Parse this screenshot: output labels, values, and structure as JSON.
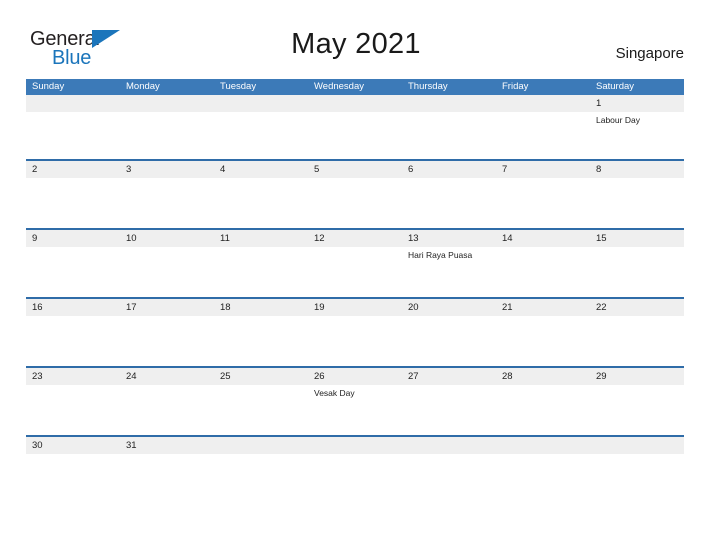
{
  "brand": {
    "name_part1": "General",
    "name_part2": "Blue",
    "flag_icon": "blue-triangle-flag",
    "primary_color": "#1b75bb"
  },
  "header": {
    "title": "May 2021",
    "region": "Singapore",
    "header_bar_color": "#3c7ab8",
    "row_band_color": "#efefef",
    "row_divider_color": "#2f6ca8"
  },
  "calendar": {
    "month": "May",
    "year": "2021",
    "weekday_headers": [
      "Sunday",
      "Monday",
      "Tuesday",
      "Wednesday",
      "Thursday",
      "Friday",
      "Saturday"
    ],
    "weeks": [
      {
        "days": [
          {
            "date": "",
            "events": []
          },
          {
            "date": "",
            "events": []
          },
          {
            "date": "",
            "events": []
          },
          {
            "date": "",
            "events": []
          },
          {
            "date": "",
            "events": []
          },
          {
            "date": "",
            "events": []
          },
          {
            "date": "1",
            "events": [
              "Labour Day"
            ]
          }
        ]
      },
      {
        "days": [
          {
            "date": "2",
            "events": []
          },
          {
            "date": "3",
            "events": []
          },
          {
            "date": "4",
            "events": []
          },
          {
            "date": "5",
            "events": []
          },
          {
            "date": "6",
            "events": []
          },
          {
            "date": "7",
            "events": []
          },
          {
            "date": "8",
            "events": []
          }
        ]
      },
      {
        "days": [
          {
            "date": "9",
            "events": []
          },
          {
            "date": "10",
            "events": []
          },
          {
            "date": "11",
            "events": []
          },
          {
            "date": "12",
            "events": []
          },
          {
            "date": "13",
            "events": [
              "Hari Raya Puasa"
            ]
          },
          {
            "date": "14",
            "events": []
          },
          {
            "date": "15",
            "events": []
          }
        ]
      },
      {
        "days": [
          {
            "date": "16",
            "events": []
          },
          {
            "date": "17",
            "events": []
          },
          {
            "date": "18",
            "events": []
          },
          {
            "date": "19",
            "events": []
          },
          {
            "date": "20",
            "events": []
          },
          {
            "date": "21",
            "events": []
          },
          {
            "date": "22",
            "events": []
          }
        ]
      },
      {
        "days": [
          {
            "date": "23",
            "events": []
          },
          {
            "date": "24",
            "events": []
          },
          {
            "date": "25",
            "events": []
          },
          {
            "date": "26",
            "events": [
              "Vesak Day"
            ]
          },
          {
            "date": "27",
            "events": []
          },
          {
            "date": "28",
            "events": []
          },
          {
            "date": "29",
            "events": []
          }
        ]
      },
      {
        "days": [
          {
            "date": "30",
            "events": []
          },
          {
            "date": "31",
            "events": []
          },
          {
            "date": "",
            "events": []
          },
          {
            "date": "",
            "events": []
          },
          {
            "date": "",
            "events": []
          },
          {
            "date": "",
            "events": []
          },
          {
            "date": "",
            "events": []
          }
        ]
      }
    ],
    "week_body_heights": [
      47,
      50,
      50,
      50,
      50,
      20
    ]
  }
}
